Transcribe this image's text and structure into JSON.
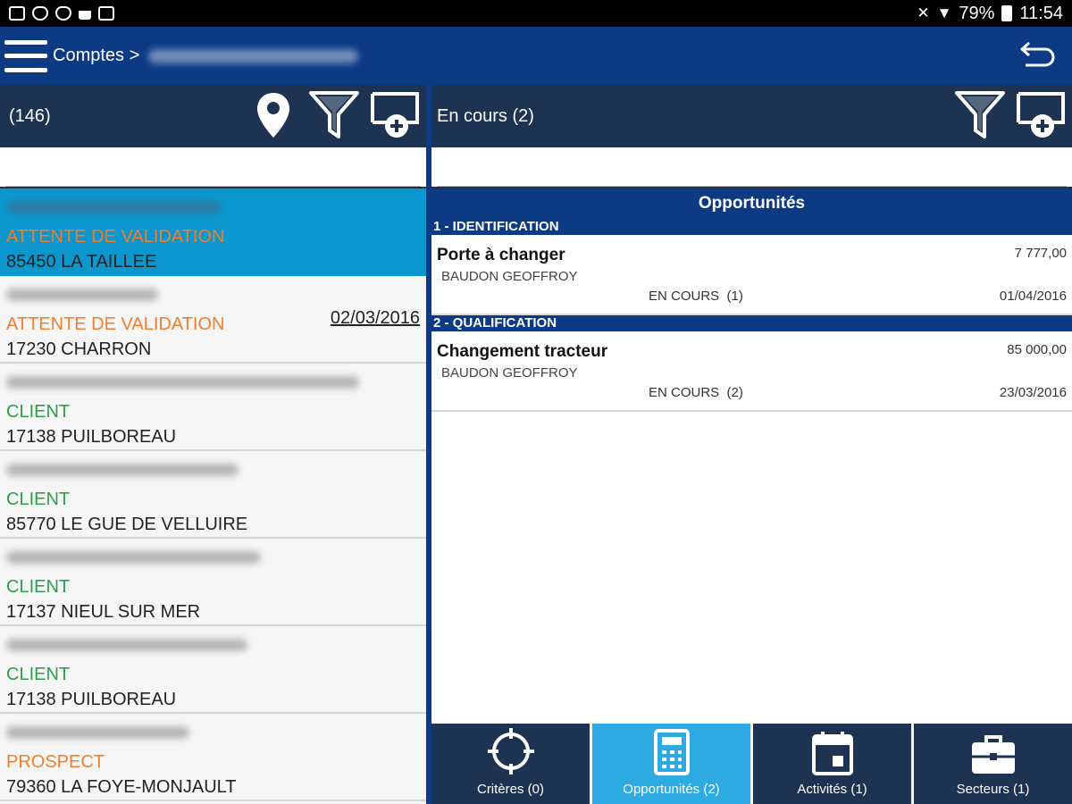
{
  "status_bar": {
    "battery": "79%",
    "time": "11:54"
  },
  "header": {
    "breadcrumb": "Comptes >"
  },
  "left_pane": {
    "count": "(146)",
    "search_placeholder": "",
    "accounts": [
      {
        "status": "ATTENTE DE VALIDATION",
        "city": "85450 LA TAILLEE",
        "date": ""
      },
      {
        "status": "ATTENTE DE VALIDATION",
        "city": "17230 CHARRON",
        "date": "02/03/2016"
      },
      {
        "status": "CLIENT",
        "city": "17138 PUILBOREAU",
        "date": ""
      },
      {
        "status": "CLIENT",
        "city": "85770 LE GUE DE VELLUIRE",
        "date": ""
      },
      {
        "status": "CLIENT",
        "city": "17137 NIEUL SUR MER",
        "date": ""
      },
      {
        "status": "CLIENT",
        "city": "17138 PUILBOREAU",
        "date": ""
      },
      {
        "status": "PROSPECT",
        "city": "79360 LA FOYE-MONJAULT",
        "date": ""
      }
    ]
  },
  "right_pane": {
    "title": "En cours (2)",
    "search_placeholder": "",
    "section_title": "Opportunités",
    "stages": [
      {
        "label": "1 - IDENTIFICATION",
        "opportunity": {
          "title": "Porte à changer",
          "amount": "7 777,00",
          "owner": "BAUDON GEOFFROY",
          "status": "EN COURS  (1)",
          "date": "01/04/2016"
        }
      },
      {
        "label": "2 - QUALIFICATION",
        "opportunity": {
          "title": "Changement tracteur",
          "amount": "85 000,00",
          "owner": "BAUDON GEOFFROY",
          "status": "EN COURS  (2)",
          "date": "23/03/2016"
        }
      }
    ]
  },
  "tabs": [
    {
      "label": "Critères (0)",
      "icon": "crosshair-icon"
    },
    {
      "label": "Opportunités (2)",
      "icon": "calculator-icon"
    },
    {
      "label": "Activités (1)",
      "icon": "calendar-icon"
    },
    {
      "label": "Secteurs (1)",
      "icon": "briefcase-icon"
    }
  ],
  "colors": {
    "primary": "#0c3a83",
    "header_dark": "#1e3352",
    "selected": "#0b97ce",
    "tab_active": "#2eaae3",
    "status_orange": "#f07e2d",
    "status_green": "#2aa147"
  }
}
